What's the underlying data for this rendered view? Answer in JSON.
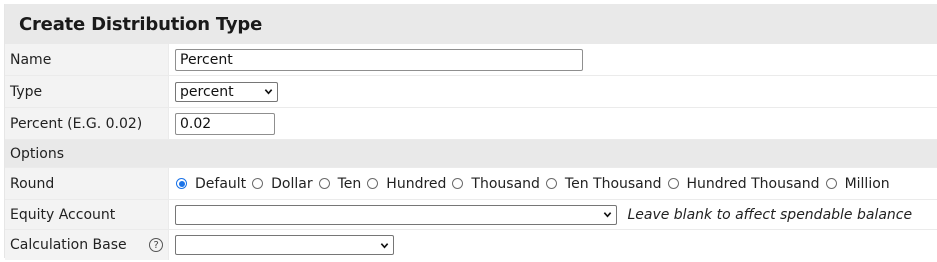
{
  "form": {
    "title": "Create Distribution Type",
    "name": {
      "label": "Name",
      "value": "Percent"
    },
    "type": {
      "label": "Type",
      "selected": "percent"
    },
    "percent": {
      "label": "Percent (E.G. 0.02)",
      "value": "0.02"
    },
    "options_section": "Options",
    "round": {
      "label": "Round",
      "options": [
        "Default",
        "Dollar",
        "Ten",
        "Hundred",
        "Thousand",
        "Ten Thousand",
        "Hundred Thousand",
        "Million"
      ],
      "selected": "Default"
    },
    "equity_account": {
      "label": "Equity Account",
      "selected": "",
      "hint": "Leave blank to affect spendable balance"
    },
    "calculation_base": {
      "label": "Calculation Base",
      "help_icon": "question-circle-icon",
      "help_glyph": "?",
      "selected": ""
    }
  },
  "colors": {
    "title_bg": "#e9e9e9",
    "label_bg": "#f3f3f3",
    "radio_accent": "#1a73e8"
  }
}
